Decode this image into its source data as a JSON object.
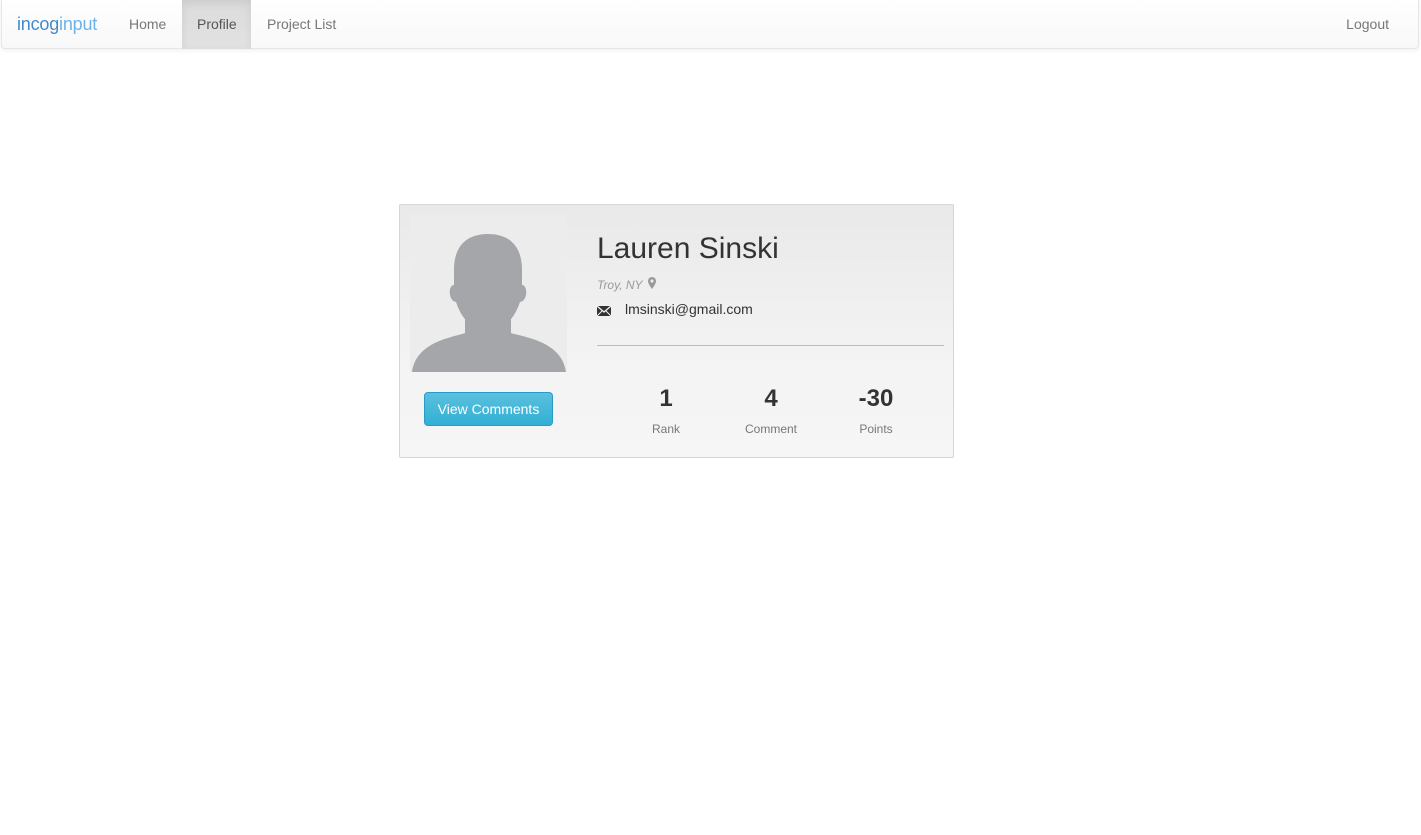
{
  "navbar": {
    "brand_part1": "incog",
    "brand_part2": "input",
    "items": [
      {
        "label": "Home"
      },
      {
        "label": "Profile"
      },
      {
        "label": "Project List"
      }
    ],
    "logout_label": "Logout"
  },
  "profile": {
    "name": "Lauren Sinski",
    "location": "Troy, NY",
    "email": "lmsinski@gmail.com",
    "view_comments_label": "View Comments",
    "stats": [
      {
        "value": "1",
        "label": "Rank"
      },
      {
        "value": "4",
        "label": "Comment"
      },
      {
        "value": "-30",
        "label": "Points"
      }
    ]
  },
  "colors": {
    "brand": "#428bca",
    "button_info": "#5bc0de",
    "avatar_silhouette": "#a4a6a9"
  }
}
